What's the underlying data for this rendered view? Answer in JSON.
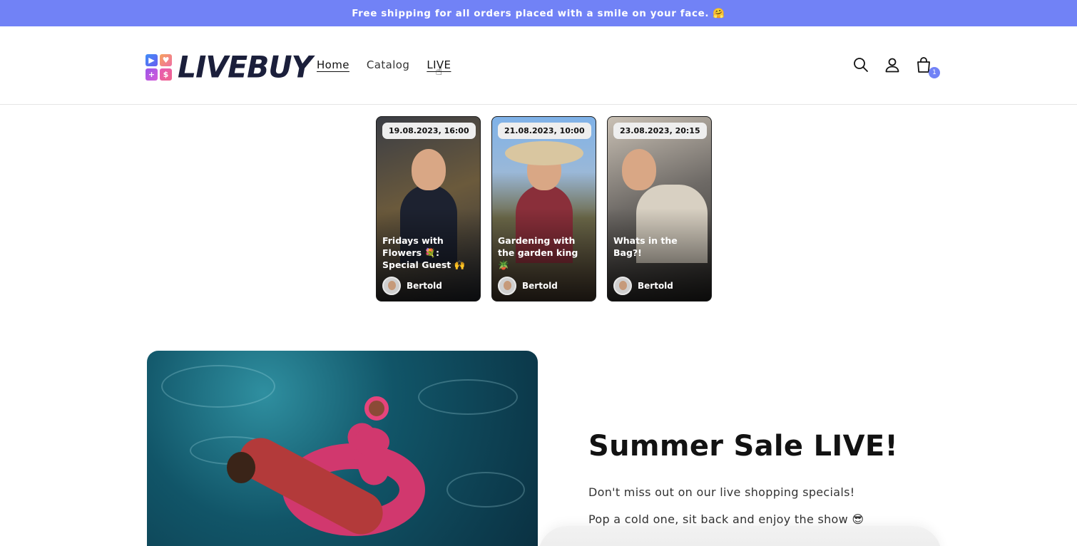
{
  "announcement": {
    "text": "Free shipping for all orders placed with a smile on your face. 🤗"
  },
  "header": {
    "logo_text": "LIVEBUY",
    "nav": [
      {
        "label": "Home",
        "active": true
      },
      {
        "label": "Catalog",
        "active": false
      },
      {
        "label": "LIVE",
        "active": false
      }
    ],
    "icons": [
      "search-icon",
      "account-icon",
      "cart-icon"
    ],
    "cart_count": "1"
  },
  "shows": [
    {
      "date": "19.08.2023, 16:00",
      "title": "Fridays with Flowers 💐: Special Guest 🙌",
      "author": "Bertold"
    },
    {
      "date": "21.08.2023, 10:00",
      "title": "Gardening with the garden king 🪴",
      "author": "Bertold"
    },
    {
      "date": "23.08.2023, 20:15",
      "title": "Whats in the Bag?!",
      "author": "Bertold"
    }
  ],
  "hero": {
    "title": "Summer Sale LIVE!",
    "paragraph1": "Don't miss out on our live shopping specials!",
    "paragraph2": "Pop a cold one, sit back and enjoy the show 😎"
  },
  "colors": {
    "accent": "#7182f6",
    "text": "#121212"
  }
}
